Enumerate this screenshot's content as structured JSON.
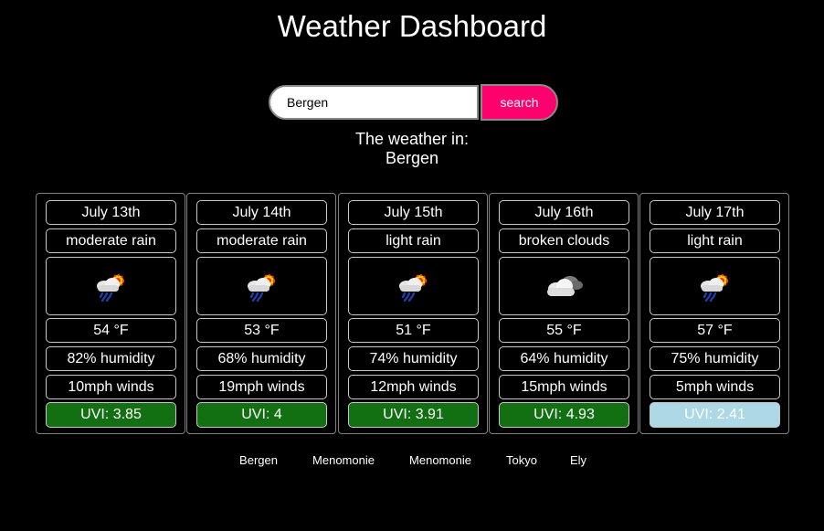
{
  "title": "Weather Dashboard",
  "search": {
    "value": "Bergen",
    "button_label": "search"
  },
  "location": {
    "heading": "The weather in:",
    "city": "Bergen"
  },
  "forecast": [
    {
      "date": "July 13th",
      "description": "moderate rain",
      "icon": "rain-cloud-sun-icon",
      "temp": "54 °F",
      "humidity": "82% humidity",
      "wind": "10mph winds",
      "uvi": "UVI: 3.85",
      "uvi_color": "#127012"
    },
    {
      "date": "July 14th",
      "description": "moderate rain",
      "icon": "rain-cloud-sun-icon",
      "temp": "53 °F",
      "humidity": "68% humidity",
      "wind": "19mph winds",
      "uvi": "UVI: 4",
      "uvi_color": "#127012"
    },
    {
      "date": "July 15th",
      "description": "light rain",
      "icon": "rain-cloud-sun-icon",
      "temp": "51 °F",
      "humidity": "74% humidity",
      "wind": "12mph winds",
      "uvi": "UVI: 3.91",
      "uvi_color": "#127012"
    },
    {
      "date": "July 16th",
      "description": "broken clouds",
      "icon": "broken-clouds-icon",
      "temp": "55 °F",
      "humidity": "64% humidity",
      "wind": "15mph winds",
      "uvi": "UVI: 4.93",
      "uvi_color": "#127012"
    },
    {
      "date": "July 17th",
      "description": "light rain",
      "icon": "rain-cloud-sun-icon",
      "temp": "57 °F",
      "humidity": "75% humidity",
      "wind": "5mph winds",
      "uvi": "UVI: 2.41",
      "uvi_color": "#add8e6"
    }
  ],
  "history": [
    "Bergen",
    "Menomonie",
    "Menomonie",
    "Tokyo",
    "Ely"
  ],
  "colors": {
    "background": "#000000",
    "search_button": "#ff006e",
    "uvi_moderate": "#127012",
    "uvi_low": "#add8e6"
  }
}
